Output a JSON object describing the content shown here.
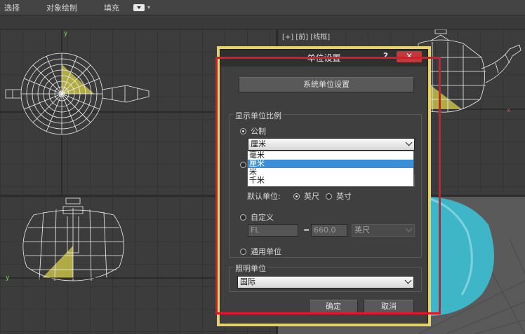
{
  "ribbon": {
    "items": [
      "选择",
      "对象绘制",
      "填充"
    ]
  },
  "viewports": {
    "front_label": "[+] [前] [线框]",
    "axis_y": "y",
    "axis_x": "x"
  },
  "dialog": {
    "title": "单位设置",
    "help": "?",
    "close": "✕",
    "system_unit_button": "系统单位设置",
    "display_group_title": "显示单位比例",
    "metric_label": "公制",
    "metric_selected": "厘米",
    "metric_options": [
      "毫米",
      "厘米",
      "米",
      "千米"
    ],
    "metric_highlight_index": 1,
    "default_unit_label": "默认单位:",
    "feet_label": "英尺",
    "inch_label": "英寸",
    "custom_label": "自定义",
    "custom_name": "FL",
    "equals": "=",
    "custom_value": "660.0",
    "custom_unit": "英尺",
    "generic_label": "通用单位",
    "lighting_group_title": "照明单位",
    "lighting_selected": "国际",
    "ok": "确定",
    "cancel": "取消"
  },
  "colors": {
    "highlight_border": "#e6d26a",
    "annotation_box": "#e0162a",
    "close_button": "#c0393b",
    "list_selection": "#3a8fd8",
    "teapot_yellow": "#e8e04a",
    "teapot_cyan": "#3fb6c8"
  }
}
